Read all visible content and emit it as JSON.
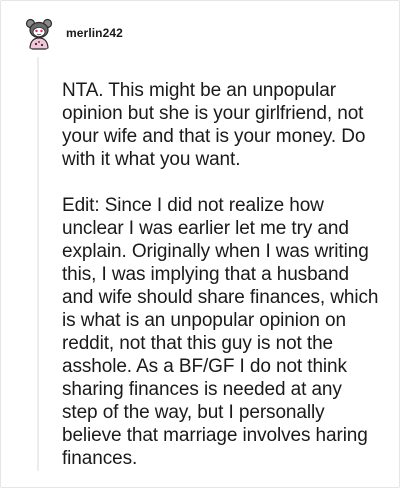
{
  "comment": {
    "username": "merlin242",
    "paragraphs": [
      "NTA. This might be an unpopular opinion but she is your girlfriend, not your wife and that is your money. Do with it what you want.",
      "Edit: Since I did not realize how unclear I was earlier let me try and explain. Originally when I was writing this, I was implying that a husband and wife should share finances, which is what is an unpopular opinion on reddit, not that this guy is not the asshole. As a BF/GF I do not think sharing finances is needed at any step of the way, but I personally believe that marriage involves haring finances."
    ]
  },
  "colors": {
    "text": "#1a1a1b",
    "thread_line": "#ececec",
    "avatar_body": "#f2c6d6",
    "avatar_head": "#6b6b6b"
  },
  "icons": {
    "avatar": "snoo-avatar-icon"
  }
}
